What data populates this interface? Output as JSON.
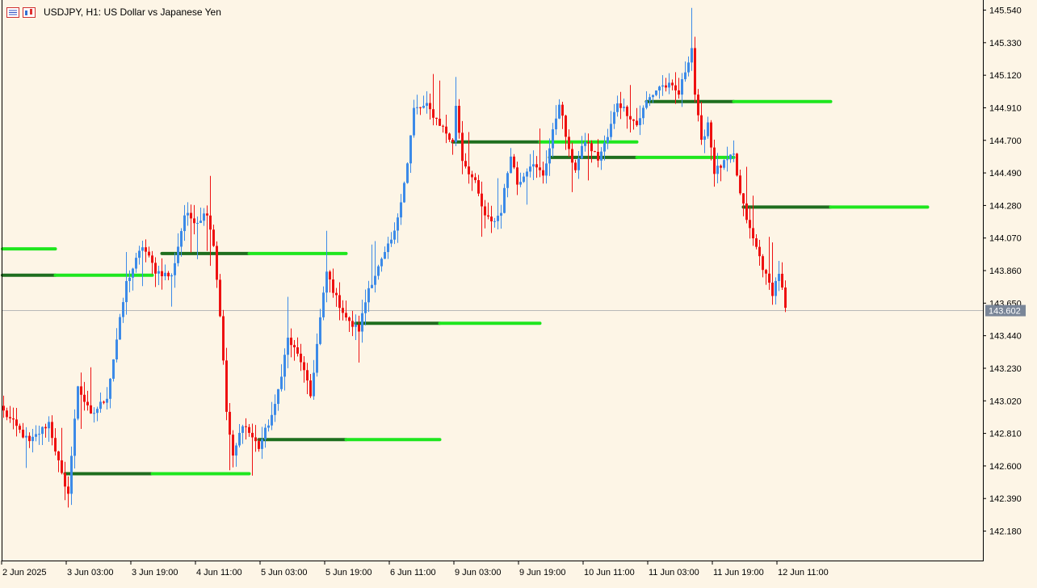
{
  "window": {
    "symbol": "USDJPY, H1:",
    "description": "US Dollar vs Japanese Yen"
  },
  "icons": [
    "list-icon",
    "chart-icon"
  ],
  "colors": {
    "background": "#fdf5e6",
    "bull_candle": "#3c8ae8",
    "bear_candle": "#ee1111",
    "level_dark": "#1e6e1e",
    "level_light": "#1ee61e",
    "price_line": "#b8b8b8",
    "price_badge": "#7a8698"
  },
  "chart_data": {
    "type": "candlestick",
    "symbol": "USDJPY",
    "timeframe": "H1",
    "ylim": [
      141.99,
      145.6
    ],
    "y_ticks": [
      "145.540",
      "145.330",
      "145.120",
      "144.910",
      "144.700",
      "144.490",
      "144.280",
      "144.070",
      "143.860",
      "143.650",
      "143.440",
      "143.230",
      "143.020",
      "142.810",
      "142.600",
      "142.390",
      "142.180"
    ],
    "x_ticks": [
      "2 Jun 2025",
      "3 Jun 03:00",
      "3 Jun 19:00",
      "4 Jun 11:00",
      "5 Jun 03:00",
      "5 Jun 19:00",
      "6 Jun 11:00",
      "9 Jun 03:00",
      "9 Jun 19:00",
      "10 Jun 11:00",
      "11 Jun 03:00",
      "11 Jun 19:00",
      "12 Jun 11:00"
    ],
    "current_price": "143.602",
    "grid": false,
    "anchors": [
      {
        "x": 0,
        "close": 142.95
      },
      {
        "x": 8,
        "close": 142.75
      },
      {
        "x": 14,
        "close": 142.88
      },
      {
        "x": 19,
        "close": 142.45
      },
      {
        "x": 20,
        "close": 142.44
      },
      {
        "x": 23,
        "close": 143.12
      },
      {
        "x": 27,
        "close": 142.92
      },
      {
        "x": 32,
        "close": 143.05
      },
      {
        "x": 38,
        "close": 143.78
      },
      {
        "x": 43,
        "close": 144.02
      },
      {
        "x": 47,
        "close": 143.86
      },
      {
        "x": 52,
        "close": 143.82
      },
      {
        "x": 56,
        "close": 144.22
      },
      {
        "x": 60,
        "close": 144.18
      },
      {
        "x": 63,
        "close": 144.24
      },
      {
        "x": 65,
        "close": 144.03
      },
      {
        "x": 67,
        "close": 143.58
      },
      {
        "x": 69,
        "close": 142.95
      },
      {
        "x": 71,
        "close": 142.65
      },
      {
        "x": 74,
        "close": 142.88
      },
      {
        "x": 79,
        "close": 142.72
      },
      {
        "x": 84,
        "close": 142.98
      },
      {
        "x": 88,
        "close": 143.42
      },
      {
        "x": 92,
        "close": 143.28
      },
      {
        "x": 95,
        "close": 143.05
      },
      {
        "x": 98,
        "close": 143.55
      },
      {
        "x": 100,
        "close": 143.85
      },
      {
        "x": 103,
        "close": 143.68
      },
      {
        "x": 107,
        "close": 143.52
      },
      {
        "x": 110,
        "close": 143.48
      },
      {
        "x": 113,
        "close": 143.75
      },
      {
        "x": 117,
        "close": 143.92
      },
      {
        "x": 121,
        "close": 144.1
      },
      {
        "x": 125,
        "close": 144.55
      },
      {
        "x": 127,
        "close": 144.9
      },
      {
        "x": 131,
        "close": 144.92
      },
      {
        "x": 136,
        "close": 144.78
      },
      {
        "x": 139,
        "close": 144.68
      },
      {
        "x": 140,
        "close": 144.93
      },
      {
        "x": 142,
        "close": 144.58
      },
      {
        "x": 146,
        "close": 144.42
      },
      {
        "x": 149,
        "close": 144.2
      },
      {
        "x": 152,
        "close": 144.18
      },
      {
        "x": 154,
        "close": 144.25
      },
      {
        "x": 157,
        "close": 144.62
      },
      {
        "x": 159,
        "close": 144.42
      },
      {
        "x": 163,
        "close": 144.55
      },
      {
        "x": 167,
        "close": 144.48
      },
      {
        "x": 169,
        "close": 144.65
      },
      {
        "x": 172,
        "close": 144.95
      },
      {
        "x": 175,
        "close": 144.62
      },
      {
        "x": 177,
        "close": 144.52
      },
      {
        "x": 180,
        "close": 144.7
      },
      {
        "x": 184,
        "close": 144.58
      },
      {
        "x": 187,
        "close": 144.72
      },
      {
        "x": 190,
        "close": 144.95
      },
      {
        "x": 193,
        "close": 144.88
      },
      {
        "x": 196,
        "close": 144.8
      },
      {
        "x": 199,
        "close": 144.95
      },
      {
        "x": 203,
        "close": 145.05
      },
      {
        "x": 206,
        "close": 145.05
      },
      {
        "x": 209,
        "close": 145.0
      },
      {
        "x": 213,
        "close": 145.3
      },
      {
        "x": 214,
        "close": 145.0
      },
      {
        "x": 216,
        "close": 144.68
      },
      {
        "x": 218,
        "close": 144.82
      },
      {
        "x": 220,
        "close": 144.5
      },
      {
        "x": 223,
        "close": 144.55
      },
      {
        "x": 226,
        "close": 144.6
      },
      {
        "x": 228,
        "close": 144.35
      },
      {
        "x": 231,
        "close": 144.12
      },
      {
        "x": 234,
        "close": 143.95
      },
      {
        "x": 236,
        "close": 143.82
      },
      {
        "x": 238,
        "close": 143.72
      },
      {
        "x": 240,
        "close": 143.85
      },
      {
        "x": 242,
        "close": 143.62
      }
    ],
    "level_lines": [
      {
        "x_start": -1,
        "x_dark_end": -1,
        "x_end": 16,
        "price": 144.0
      },
      {
        "x_start": -1,
        "x_dark_end": 16,
        "x_end": 46,
        "price": 143.83
      },
      {
        "x_start": 49,
        "x_dark_end": 76,
        "x_end": 106,
        "price": 143.97
      },
      {
        "x_start": 19,
        "x_dark_end": 46,
        "x_end": 76,
        "price": 142.55
      },
      {
        "x_start": 79,
        "x_dark_end": 106,
        "x_end": 135,
        "price": 142.77
      },
      {
        "x_start": 109,
        "x_dark_end": 135,
        "x_end": 166,
        "price": 143.52
      },
      {
        "x_start": 139,
        "x_dark_end": 166,
        "x_end": 196,
        "price": 144.69
      },
      {
        "x_start": 169,
        "x_dark_end": 196,
        "x_end": 226,
        "price": 144.59
      },
      {
        "x_start": 199,
        "x_dark_end": 226,
        "x_end": 256,
        "price": 144.95
      },
      {
        "x_start": 229,
        "x_dark_end": 256,
        "x_end": 286,
        "price": 144.27
      }
    ]
  }
}
